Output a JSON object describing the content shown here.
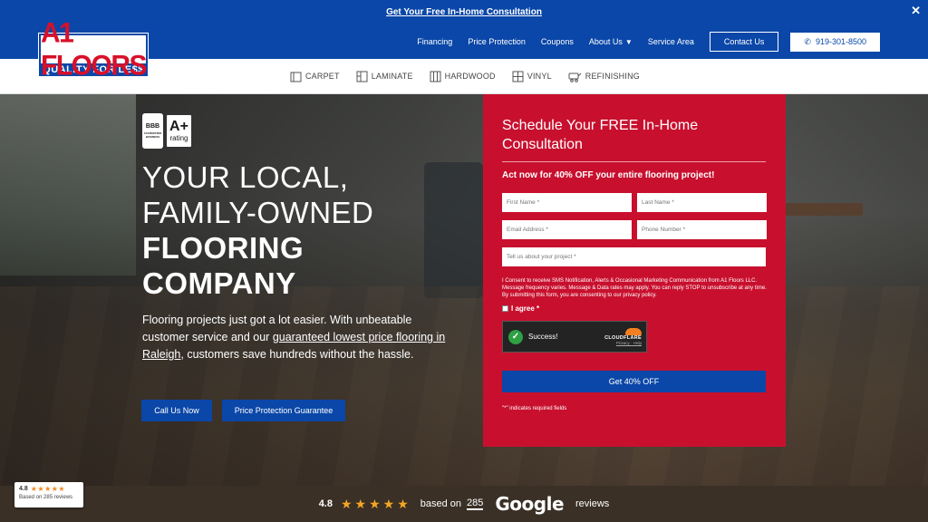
{
  "promo": {
    "text": "Get Your Free In-Home Consultation",
    "close": "✕"
  },
  "logo": {
    "main": "A1 FLOORS",
    "tagline": "QUALITY FOR LE$$"
  },
  "nav": {
    "items": [
      "Financing",
      "Price Protection",
      "Coupons",
      "About Us",
      "Service Area"
    ],
    "contact": "Contact Us",
    "phone": "919-301-8500"
  },
  "categories": [
    {
      "label": "CARPET",
      "icon": "carpet-icon"
    },
    {
      "label": "LAMINATE",
      "icon": "laminate-icon"
    },
    {
      "label": "HARDWOOD",
      "icon": "hardwood-icon"
    },
    {
      "label": "VINYL",
      "icon": "vinyl-icon"
    },
    {
      "label": "REFINISHING",
      "icon": "refinishing-icon"
    }
  ],
  "bbb": {
    "letters": "BBB",
    "sub": "ACCREDITED BUSINESS",
    "grade": "A+",
    "rating": "rating"
  },
  "hero": {
    "line1": "YOUR LOCAL,",
    "line2": "FAMILY-OWNED",
    "line3": "FLOORING",
    "line4": "COMPANY",
    "desc_a": "Flooring projects just got a lot easier. With unbeatable customer service and our ",
    "desc_link": "guaranteed lowest price flooring in Raleigh",
    "desc_b": ", customers save hundreds without the hassle.",
    "btn_call": "Call Us Now",
    "btn_price": "Price Protection Guarantee"
  },
  "form": {
    "title": "Schedule Your FREE In-Home Consultation",
    "subtitle": "Act now for 40% OFF your entire flooring project!",
    "first_name": "First Name *",
    "last_name": "Last Name *",
    "email": "Email Address *",
    "phone": "Phone Number *",
    "project": "Tell us about your project *",
    "consent": "I Consent to receive SMS Notification, Alerts & Occasional Marketing Communication from A1 Floors LLC. Message frequency varies. Message & Data rates may apply. You can reply STOP to unsubscribe at any time. By submitting this form, you are consenting to our privacy policy.",
    "agree": "I agree *",
    "captcha_status": "Success!",
    "captcha_brand": "CLOUDFLARE",
    "captcha_links": "Privacy · Help",
    "submit": "Get 40% OFF",
    "required_note": "\"*\" indicates required fields"
  },
  "reviews": {
    "score": "4.8",
    "stars": "★★★★★",
    "based_on": "based on",
    "count": "285",
    "brand": "Google",
    "suffix": "reviews",
    "badge_based": "Based on 285 reviews"
  },
  "colors": {
    "brand_blue": "#0a47a8",
    "brand_red": "#c8102e",
    "star": "#f5a623"
  }
}
